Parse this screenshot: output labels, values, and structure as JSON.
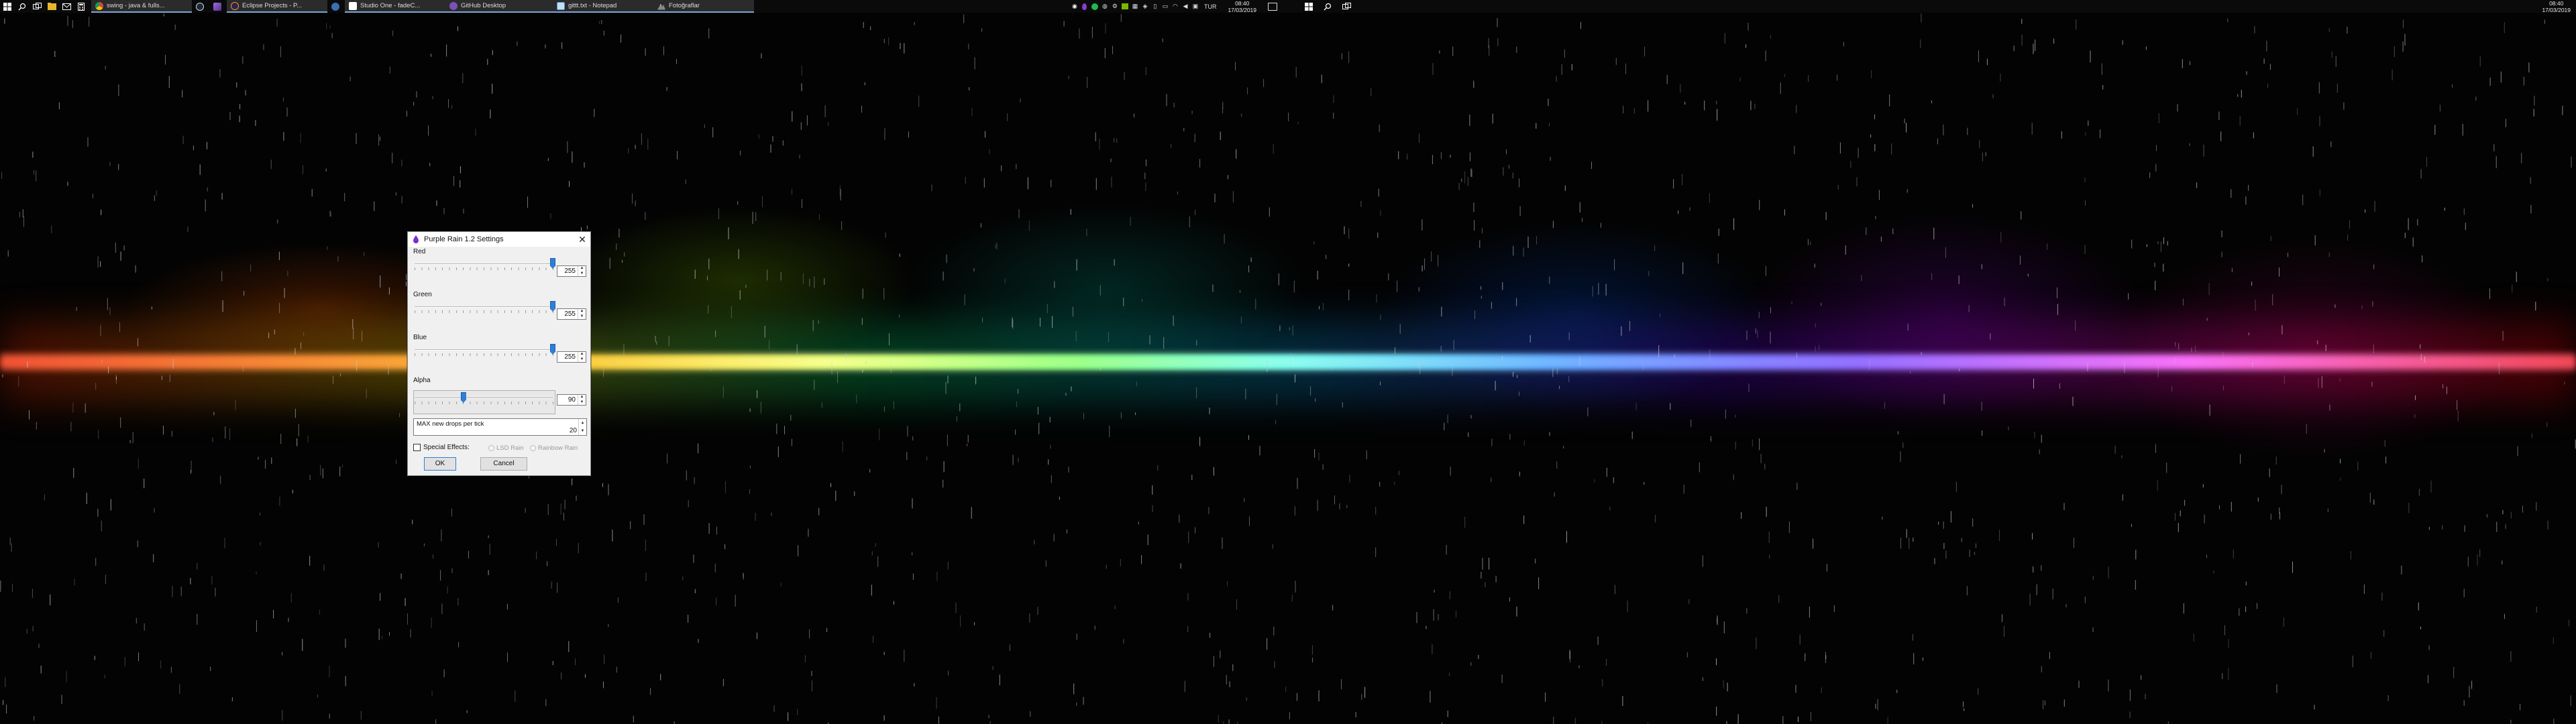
{
  "colors": {
    "taskbar": "#0a0a0a",
    "thumb": "#2f7fd6",
    "dialog_bg": "#f0f0f0"
  },
  "taskbar": {
    "left_icons": [
      "windows-logo-icon",
      "search-icon",
      "task-view-icon",
      "file-explorer-icon",
      "mail-icon",
      "calculator-icon"
    ],
    "apps": [
      {
        "label": "swing - java & fulls...",
        "icon": "chrome-icon"
      },
      {
        "label": "",
        "icon": "steam-icon"
      },
      {
        "label": "",
        "icon": "visual-studio-icon"
      },
      {
        "label": "Eclipse Projects - P...",
        "icon": "eclipse-icon"
      },
      {
        "label": "",
        "icon": "app-icon"
      },
      {
        "label": "Studio One - fadeC...",
        "icon": "studio-one-icon"
      },
      {
        "label": "GitHub Desktop",
        "icon": "github-desktop-icon"
      },
      {
        "label": "gittt.txt - Notepad",
        "icon": "notepad-icon"
      },
      {
        "label": "Fotoğraflar",
        "icon": "photos-icon"
      }
    ],
    "lang": "TUR",
    "time": "08:40",
    "date": "17/03/2019"
  },
  "taskbar2": {
    "time": "08:40",
    "date": "17/03/2019"
  },
  "dialog": {
    "title": "Purple Rain 1.2 Settings",
    "close": "✕",
    "sliders": [
      {
        "label": "Red",
        "value": "255",
        "level": 255,
        "max": 255
      },
      {
        "label": "Green",
        "value": "255",
        "level": 255,
        "max": 255
      },
      {
        "label": "Blue",
        "value": "255",
        "level": 255,
        "max": 255
      },
      {
        "label": "Alpha",
        "value": "90",
        "level": 90,
        "max": 255
      }
    ],
    "max_drops_label": "MAX new drops per tick",
    "max_drops_value": "20",
    "special_effects_label": "Special Effects:",
    "lsd_rain_label": "LSD Rain",
    "rainbow_rain_label": "Rainbow Rain",
    "ok": "OK",
    "cancel": "Cancel"
  }
}
